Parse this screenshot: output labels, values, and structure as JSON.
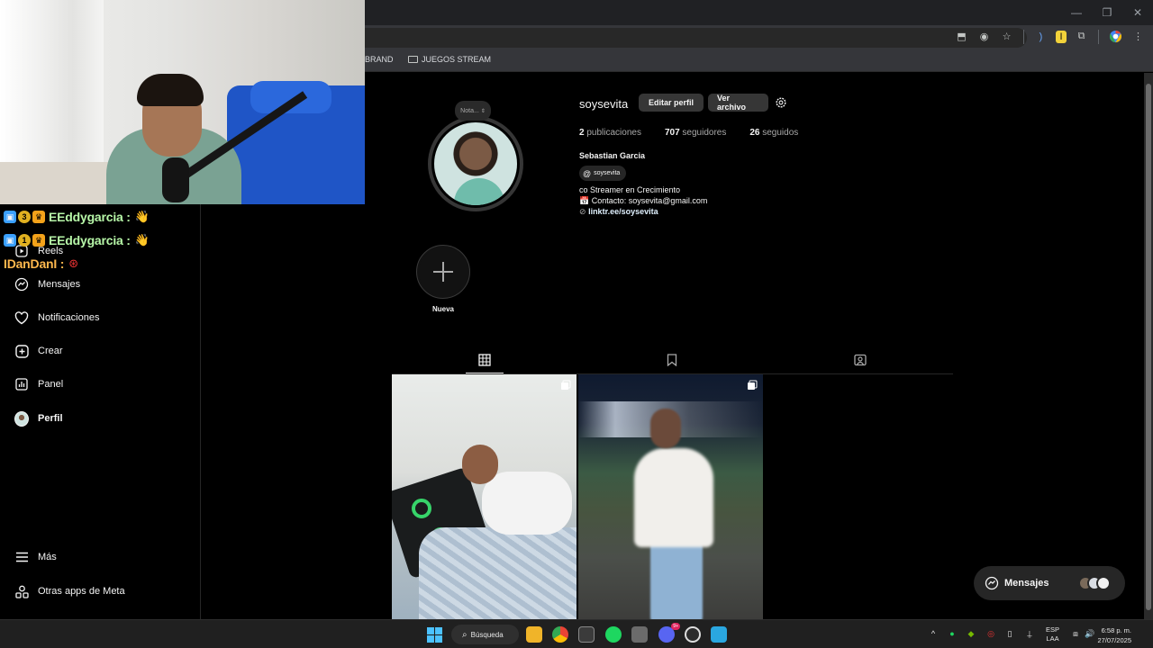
{
  "browser": {
    "bookmarks": [
      {
        "label": "BRAND"
      },
      {
        "label": "JUEGOS STREAM"
      }
    ]
  },
  "chat": [
    {
      "user": "EEddygarcia :",
      "badge_count": "x"
    },
    {
      "user": "EEddygarcia :",
      "badge_count": ""
    },
    {
      "user": "IDanDanI :",
      "badge_count": ""
    }
  ],
  "sidebar": {
    "items": [
      {
        "label": "Reels",
        "icon": "reels-icon"
      },
      {
        "label": "Mensajes",
        "icon": "messenger-icon"
      },
      {
        "label": "Notificaciones",
        "icon": "heart-icon"
      },
      {
        "label": "Crear",
        "icon": "plus-square-icon"
      },
      {
        "label": "Panel",
        "icon": "chart-icon"
      },
      {
        "label": "Perfil",
        "icon": "profile-avatar"
      },
      {
        "label": "Más",
        "icon": "menu-icon"
      },
      {
        "label": "Otras apps de Meta",
        "icon": "meta-apps-icon"
      }
    ]
  },
  "profile": {
    "note": "Nota...",
    "username": "soysevita",
    "edit_button": "Editar perfil",
    "archive_button": "Ver archivo",
    "stats": {
      "posts_count": "2",
      "posts_label": "publicaciones",
      "followers_count": "707",
      "followers_label": "seguidores",
      "following_count": "26",
      "following_label": "seguidos"
    },
    "full_name": "Sebastian Garcia",
    "threads_handle": "soysevita",
    "bio_line1": "co Streamer en Crecimiento",
    "bio_line2": "📅 Contacto: soysevita@gmail.com",
    "bio_link": "linktr.ee/soysevita",
    "highlight_label": "Nueva"
  },
  "messages_pill": {
    "label": "Mensajes"
  },
  "taskbar": {
    "search_label": "Búsqueda",
    "discord_badge": "9+",
    "lang_top": "ESP",
    "lang_bottom": "LAA",
    "time": "6:58 p. m.",
    "date": "27/07/2025"
  },
  "colors": {
    "background": "#000000",
    "surface": "#262626",
    "button": "#363636",
    "text": "#f5f5f5",
    "muted": "#a8a8a8",
    "chat_green": "#b7f7a8",
    "chat_orange": "#ffb84d"
  }
}
